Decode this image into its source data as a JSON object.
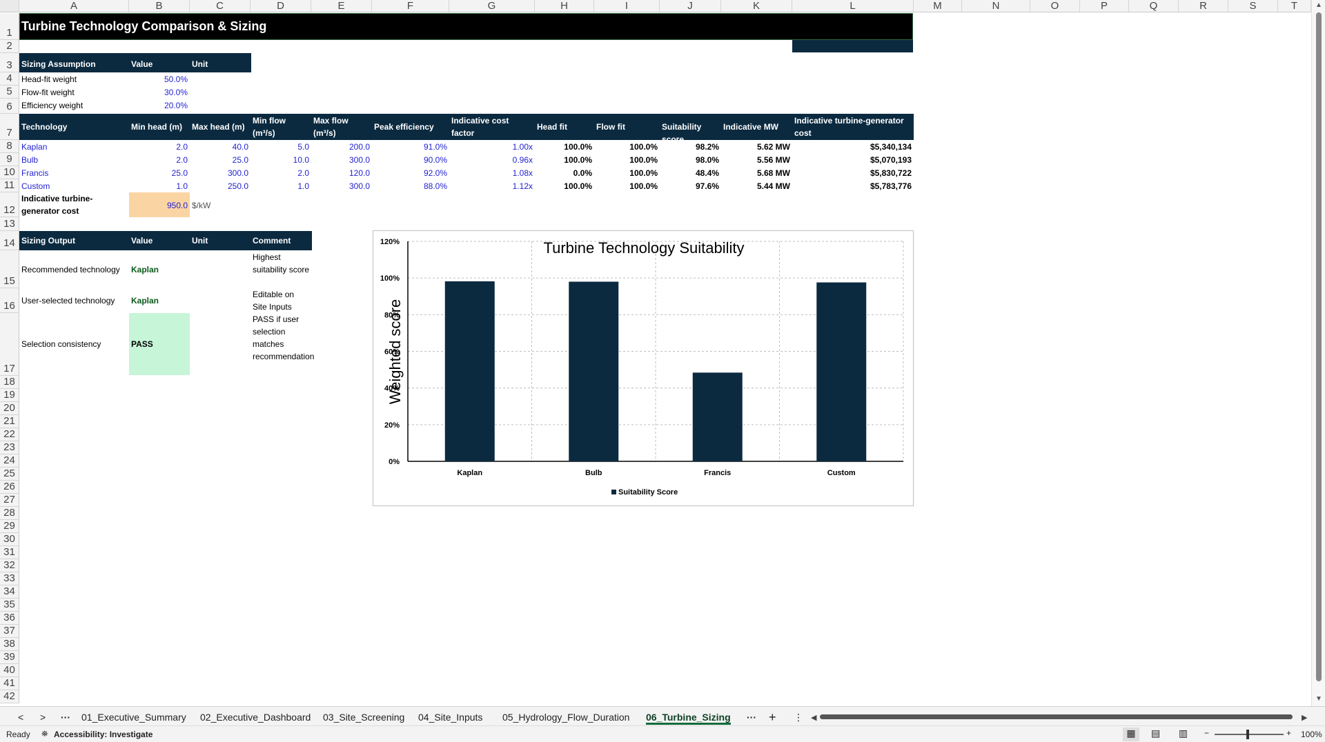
{
  "columns": [
    "A",
    "B",
    "C",
    "D",
    "E",
    "F",
    "G",
    "H",
    "I",
    "J",
    "K",
    "L",
    "M",
    "N",
    "O",
    "P",
    "Q",
    "R",
    "S",
    "T"
  ],
  "rows": [
    "1",
    "2",
    "3",
    "4",
    "5",
    "6",
    "7",
    "8",
    "9",
    "10",
    "11",
    "12",
    "13",
    "14",
    "15",
    "16",
    "17",
    "18",
    "19",
    "20",
    "21",
    "22",
    "23",
    "24",
    "25",
    "26",
    "27",
    "28",
    "29",
    "30",
    "31",
    "32",
    "33",
    "34",
    "35",
    "36",
    "37",
    "38",
    "39",
    "40",
    "41",
    "42"
  ],
  "title": "Turbine Technology Comparison & Sizing",
  "assumptions": {
    "headers": [
      "Sizing Assumption",
      "Value",
      "Unit"
    ],
    "rows": [
      {
        "label": "Head-fit weight",
        "value": "50.0%"
      },
      {
        "label": "Flow-fit weight",
        "value": "30.0%"
      },
      {
        "label": "Efficiency weight",
        "value": "20.0%"
      }
    ]
  },
  "tech_table": {
    "headers": [
      "Technology",
      "Min head (m)",
      "Max head (m)",
      "Min flow (m³/s)",
      "Max flow (m³/s)",
      "Peak efficiency",
      "Indicative cost factor",
      "Head fit",
      "Flow fit",
      "Suitability score",
      "Indicative MW",
      "Indicative turbine-generator cost"
    ],
    "rows": [
      [
        "Kaplan",
        "2.0",
        "40.0",
        "5.0",
        "200.0",
        "91.0%",
        "1.00x",
        "100.0%",
        "100.0%",
        "98.2%",
        "5.62 MW",
        "$5,340,134"
      ],
      [
        "Bulb",
        "2.0",
        "25.0",
        "10.0",
        "300.0",
        "90.0%",
        "0.96x",
        "100.0%",
        "100.0%",
        "98.0%",
        "5.56 MW",
        "$5,070,193"
      ],
      [
        "Francis",
        "25.0",
        "300.0",
        "2.0",
        "120.0",
        "92.0%",
        "1.08x",
        "0.0%",
        "100.0%",
        "48.4%",
        "5.68 MW",
        "$5,830,722"
      ],
      [
        "Custom",
        "1.0",
        "250.0",
        "1.0",
        "300.0",
        "88.0%",
        "1.12x",
        "100.0%",
        "100.0%",
        "97.6%",
        "5.44 MW",
        "$5,783,776"
      ]
    ]
  },
  "cost_row": {
    "label": "Indicative turbine-generator cost",
    "value": "950.0",
    "unit": "$/kW"
  },
  "output": {
    "headers": [
      "Sizing Output",
      "Value",
      "Unit",
      "Comment"
    ],
    "rows": [
      {
        "label": "Recommended technology",
        "value": "Kaplan",
        "comment": "Highest suitability score"
      },
      {
        "label": "User-selected technology",
        "value": "Kaplan",
        "comment": "Editable on Site Inputs"
      },
      {
        "label": "Selection consistency",
        "value": "PASS",
        "comment": "PASS if user selection matches recommendation"
      }
    ]
  },
  "chart_data": {
    "type": "bar",
    "title": "Turbine Technology Suitability",
    "ylabel": "Weighted score",
    "xlabel": "",
    "categories": [
      "Kaplan",
      "Bulb",
      "Francis",
      "Custom"
    ],
    "series": [
      {
        "name": "Suitability Score",
        "values": [
          0.982,
          0.98,
          0.484,
          0.976
        ]
      }
    ],
    "ylim": [
      0,
      1.2
    ],
    "yticks": [
      "0%",
      "20%",
      "40%",
      "60%",
      "80%",
      "100%",
      "120%"
    ],
    "grid": true,
    "legend": "bottom",
    "bar_color": "#0b2a40"
  },
  "tabs": {
    "items": [
      "01_Executive_Summary",
      "02_Executive_Dashboard",
      "03_Site_Screening",
      "04_Site_Inputs",
      "05_Hydrology_Flow_Duration",
      "06_Turbine_Sizing"
    ],
    "active": "06_Turbine_Sizing"
  },
  "status": {
    "ready": "Ready",
    "accessibility": "Accessibility: Investigate",
    "zoom": "100%"
  },
  "colors": {
    "header_band": "#0b2a40",
    "input_blue": "#1f1fd1",
    "cost_input_fill": "#fbd4a4",
    "pass_fill": "#c6f5d8"
  }
}
